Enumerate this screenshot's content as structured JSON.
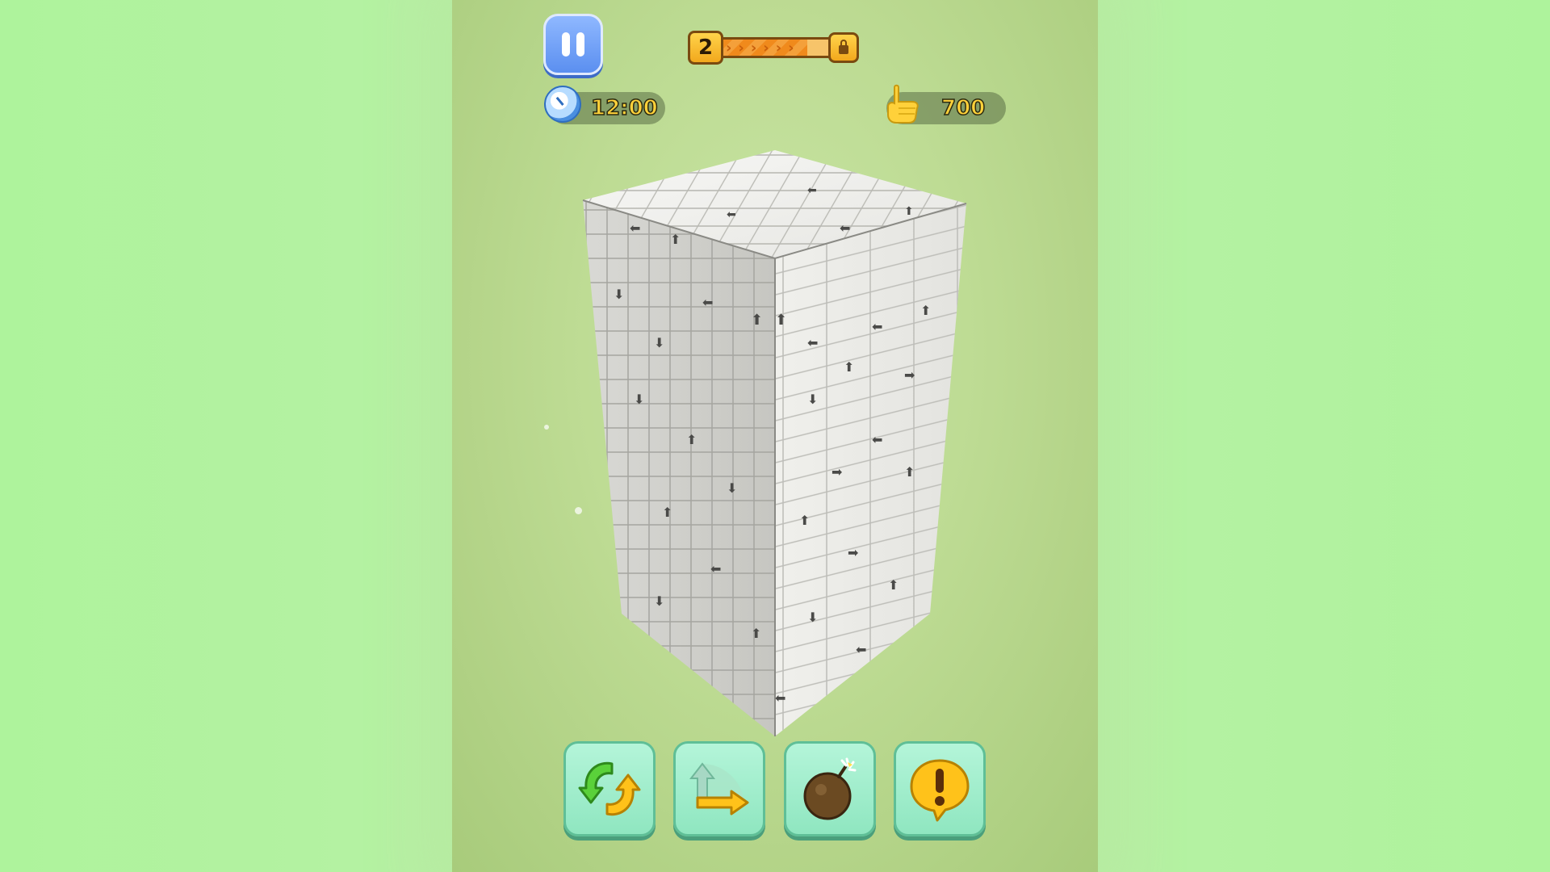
{
  "hud": {
    "level": "2",
    "level_progress": 0.8,
    "timer": "12:00",
    "coins": "700"
  },
  "toolbar": {
    "tools": [
      {
        "name": "rotate",
        "icon": "rotate-arrows-icon"
      },
      {
        "name": "move",
        "icon": "corner-arrow-icon"
      },
      {
        "name": "bomb",
        "icon": "bomb-icon"
      },
      {
        "name": "hint",
        "icon": "exclamation-bubble-icon"
      }
    ]
  },
  "colors": {
    "background": "#b3f19f",
    "pause_button": "#5b8ff0",
    "tool_button": "#8fe6c0",
    "level_bar": "#f2a81d",
    "text_gold": "#ffd13a"
  }
}
